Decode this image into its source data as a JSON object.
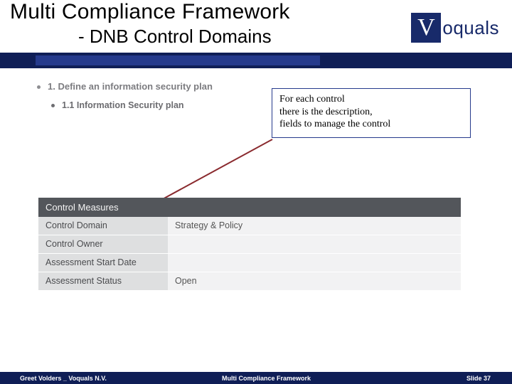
{
  "header": {
    "title": "Multi Compliance Framework",
    "subtitle": "- DNB Control Domains"
  },
  "logo": {
    "mark": "V",
    "text": "oquals"
  },
  "bullets": {
    "b1": "1. Define an information security plan",
    "b2": "1.1 Information Security plan"
  },
  "callout": "For each control\nthere is the description,\nfields to manage the control",
  "table": {
    "header": "Control Measures",
    "rows": [
      {
        "label": "Control Domain",
        "value": "Strategy & Policy"
      },
      {
        "label": "Control Owner",
        "value": ""
      },
      {
        "label": "Assessment Start Date",
        "value": ""
      },
      {
        "label": "Assessment Status",
        "value": "Open"
      }
    ]
  },
  "footer": {
    "left": "Greet Volders _ Voquals N.V.",
    "mid": "Multi Compliance Framework",
    "right_prefix": "Slide ",
    "right_num": "37"
  }
}
